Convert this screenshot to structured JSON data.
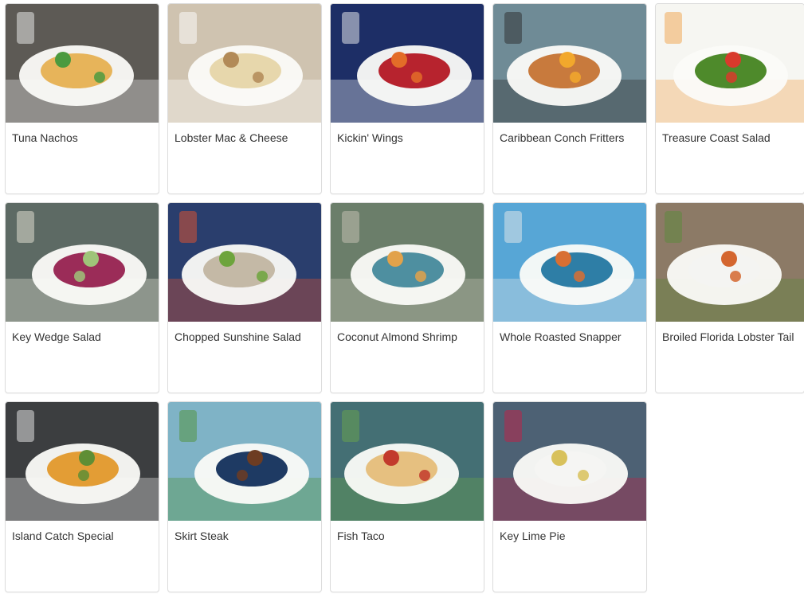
{
  "menu": {
    "items": [
      {
        "name": "Tuna Nachos",
        "image": "tuna-nachos-photo",
        "colors": [
          "#5d5a55",
          "#e7b45a",
          "#4c9a3f",
          "#f1f1f1"
        ]
      },
      {
        "name": "Lobster Mac & Cheese",
        "image": "lobster-mac-photo",
        "colors": [
          "#cfc3b0",
          "#e7d7ac",
          "#b28a57",
          "#ffffff"
        ]
      },
      {
        "name": "Kickin' Wings",
        "image": "wings-photo",
        "colors": [
          "#1d2e66",
          "#b7232e",
          "#e36c28",
          "#f4f4f4"
        ]
      },
      {
        "name": "Caribbean Conch Fritters",
        "image": "conch-fritters-photo",
        "colors": [
          "#6f8b96",
          "#c87a3d",
          "#f2a82c",
          "#2b2b2b"
        ]
      },
      {
        "name": "Treasure Coast Salad",
        "image": "treasure-coast-salad-photo",
        "colors": [
          "#f6f6f2",
          "#4e8a2b",
          "#d83a2c",
          "#f0a14a"
        ]
      },
      {
        "name": "Key Wedge Salad",
        "image": "key-wedge-salad-photo",
        "colors": [
          "#5d6a64",
          "#9b2c58",
          "#9fc479",
          "#e9e6d8"
        ]
      },
      {
        "name": "Chopped Sunshine Salad",
        "image": "chopped-sunshine-salad-photo",
        "colors": [
          "#2a3e6d",
          "#c4b9a6",
          "#6da43c",
          "#e6532e"
        ]
      },
      {
        "name": "Coconut Almond Shrimp",
        "image": "coconut-shrimp-photo",
        "colors": [
          "#6b7e6a",
          "#4e8fa0",
          "#e2a24a",
          "#c9c3b5"
        ]
      },
      {
        "name": "Whole Roasted Snapper",
        "image": "whole-snapper-photo",
        "colors": [
          "#57a6d6",
          "#2e7ea6",
          "#d86f33",
          "#e9e9e9"
        ]
      },
      {
        "name": "Broiled Florida Lobster Tail",
        "image": "lobster-tail-photo",
        "colors": [
          "#8c7a66",
          "#f4f4f2",
          "#d4662f",
          "#5a8a39"
        ]
      },
      {
        "name": "Island Catch Special",
        "image": "island-catch-photo",
        "colors": [
          "#3c3e40",
          "#e39d35",
          "#5f8e35",
          "#eeeeee"
        ]
      },
      {
        "name": "Skirt Steak",
        "image": "skirt-steak-photo",
        "colors": [
          "#7fb3c6",
          "#1e3a63",
          "#6d3c22",
          "#4f9135"
        ]
      },
      {
        "name": "Fish Taco",
        "image": "fish-taco-photo",
        "colors": [
          "#446f74",
          "#e6c080",
          "#c23a2c",
          "#69a54b"
        ]
      },
      {
        "name": "Key Lime Pie",
        "image": "key-lime-pie-photo",
        "colors": [
          "#4d6174",
          "#f5f5f3",
          "#d8c15b",
          "#c41f45"
        ]
      }
    ]
  }
}
